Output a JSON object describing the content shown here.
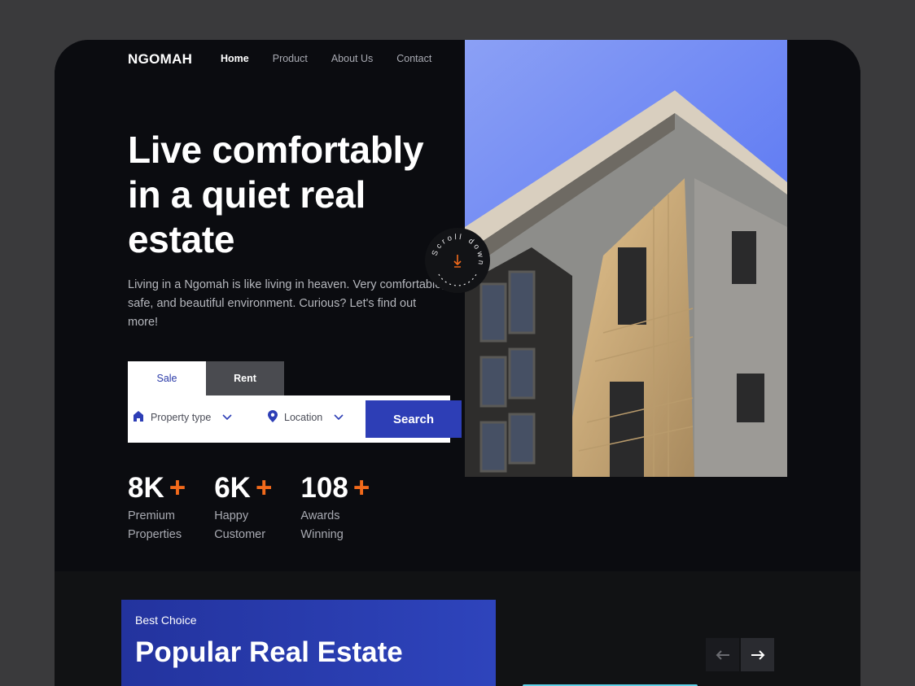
{
  "brand": {
    "logo": "NGOMAH"
  },
  "nav": {
    "items": [
      "Home",
      "Product",
      "About Us",
      "Contact"
    ],
    "active": "Home"
  },
  "hero": {
    "headline_lines": [
      "Live comfortably",
      "in a quiet real",
      "estate"
    ],
    "description": "Living in a Ngomah is like living in heaven. Very comfortable, safe, and beautiful environment. Curious? Let's find out more!",
    "scroll_text": "Scroll down"
  },
  "search": {
    "tabs": [
      "Sale",
      "Rent"
    ],
    "active_tab": "Sale",
    "property_type_placeholder": "Property type",
    "location_placeholder": "Location",
    "button_label": "Search"
  },
  "stats": [
    {
      "value": "8K",
      "plus": "+",
      "label_lines": [
        "Premium",
        "Properties"
      ]
    },
    {
      "value": "6K",
      "plus": "+",
      "label_lines": [
        "Happy",
        "Customer"
      ]
    },
    {
      "value": "108",
      "plus": "+",
      "label_lines": [
        "Awards",
        "Winning"
      ]
    }
  ],
  "popular": {
    "kicker": "Best Choice",
    "title": "Popular Real Estate"
  },
  "colors": {
    "accent_blue": "#2d3eb6",
    "accent_orange": "#f26a1b",
    "background": "#0b0c10"
  },
  "icons": [
    "home-icon",
    "location-pin-icon",
    "chevron-down-icon",
    "arrow-down-icon",
    "arrow-left-icon",
    "arrow-right-icon"
  ]
}
